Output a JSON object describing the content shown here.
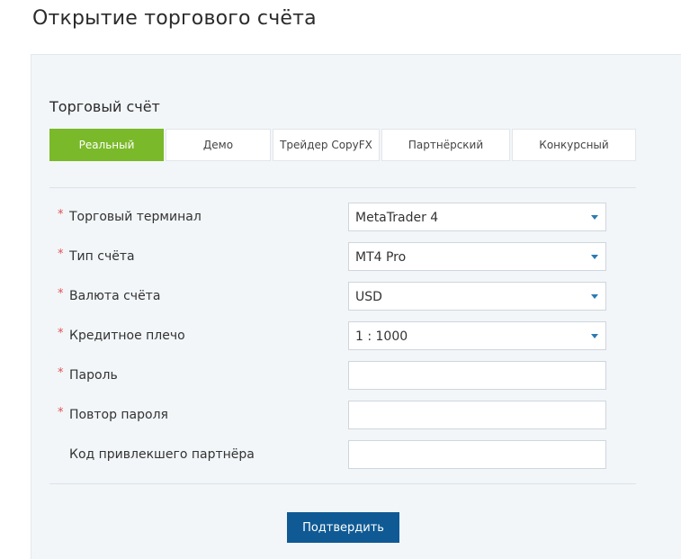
{
  "page": {
    "title": "Открытие торгового счёта"
  },
  "account": {
    "section_title": "Торговый счёт",
    "tabs": [
      {
        "label": "Реальный",
        "active": true
      },
      {
        "label": "Демо",
        "active": false
      },
      {
        "label": "Трейдер CopyFX",
        "active": false
      },
      {
        "label": "Партнёрский",
        "active": false
      },
      {
        "label": "Конкурсный",
        "active": false
      }
    ]
  },
  "form": {
    "required_mark": "*",
    "fields": [
      {
        "label": "Торговый терминал",
        "required": true,
        "type": "select",
        "value": "MetaTrader 4"
      },
      {
        "label": "Тип счёта",
        "required": true,
        "type": "select",
        "value": "MT4 Pro"
      },
      {
        "label": "Валюта счёта",
        "required": true,
        "type": "select",
        "value": "USD"
      },
      {
        "label": "Кредитное плечо",
        "required": true,
        "type": "select",
        "value": "1 : 1000"
      },
      {
        "label": "Пароль",
        "required": true,
        "type": "password",
        "value": ""
      },
      {
        "label": "Повтор пароля",
        "required": true,
        "type": "password",
        "value": ""
      },
      {
        "label": "Код привлекшего партнёра",
        "required": false,
        "type": "text",
        "value": ""
      }
    ],
    "submit_label": "Подтвердить"
  },
  "colors": {
    "active_tab": "#7ab929",
    "submit_button": "#0f5a94",
    "required_asterisk": "#e05050",
    "select_caret": "#2a7ab3",
    "panel_background": "#f2f6f9"
  }
}
